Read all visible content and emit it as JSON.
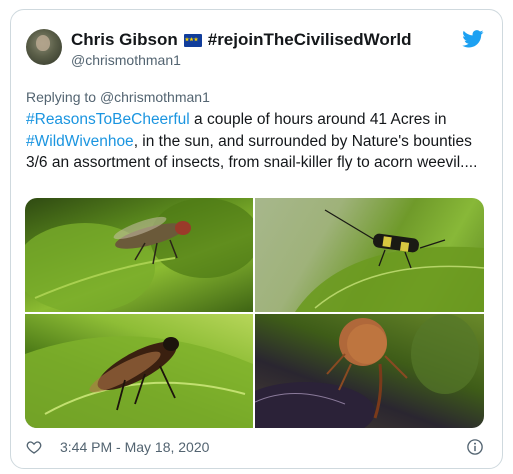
{
  "user": {
    "display_name": "Chris Gibson",
    "flag_icon": "eu-flag-icon",
    "hashtag_name": "#rejoinTheCivilisedWorld",
    "handle": "@chrismothman1"
  },
  "reply": {
    "prefix": "Replying to ",
    "mention": "@chrismothman1"
  },
  "tweet": {
    "hashtag1": "#ReasonsToBeCheerful",
    "text1": " a couple of hours around 41 Acres in ",
    "hashtag2": "#WildWivenhoe",
    "text2": ", in the sun, and surrounded by Nature's bounties 3/6 an assortment of insects, from snail-killer fly to acorn weevil...."
  },
  "media": {
    "photos": [
      {
        "subject": "snail-killer fly on leaf"
      },
      {
        "subject": "black and yellow bug on leaf"
      },
      {
        "subject": "fly on green leaf"
      },
      {
        "subject": "acorn weevil"
      }
    ]
  },
  "footer": {
    "timestamp": "3:44 PM - May 18, 2020"
  },
  "colors": {
    "link": "#1b95e0",
    "twitter_blue": "#1da1f2",
    "muted": "#536471"
  }
}
